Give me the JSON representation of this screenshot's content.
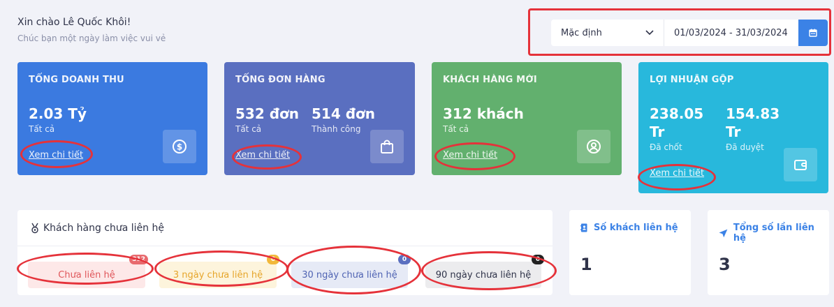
{
  "greeting": {
    "title": "Xin chào Lê Quốc Khôi!",
    "subtitle": "Chúc bạn một ngày làm việc vui vẻ"
  },
  "filter": {
    "preset": "Mặc định",
    "date_range": "01/03/2024 - 31/03/2024"
  },
  "cards": {
    "revenue": {
      "title": "TỔNG DOANH THU",
      "value": "2.03 Tỷ",
      "label": "Tất cả",
      "link": "Xem chi tiết",
      "color": "#3b7ae0",
      "icon": "dollar-coin-icon"
    },
    "orders": {
      "title": "TỔNG ĐƠN HÀNG",
      "value1": "532 đơn",
      "label1": "Tất cả",
      "value2": "514 đơn",
      "label2": "Thành công",
      "link": "Xem chi tiết",
      "color": "#5a6fc0",
      "icon": "shopping-bag-icon"
    },
    "customers": {
      "title": "KHÁCH HÀNG MỚI",
      "value": "312 khách",
      "label": "Tất cả",
      "link": "Xem chi tiết",
      "color": "#62b06e",
      "icon": "user-circle-icon"
    },
    "profit": {
      "title": "LỢI NHUẬN GỘP",
      "value1": "238.05 Tr",
      "label1": "Đã chốt",
      "value2": "154.83 Tr",
      "label2": "Đã duyệt",
      "link": "Xem chi tiết",
      "color": "#28b8dc",
      "icon": "wallet-icon"
    }
  },
  "uncontacted": {
    "title": "Khách hàng chưa liên hệ",
    "pills": [
      {
        "label": "Chưa liên hệ",
        "count": "312",
        "bg": "#fde8e8",
        "fg": "#e0575b",
        "badge": "#e86a6e"
      },
      {
        "label": "3 ngày chưa liên hệ",
        "count": "0",
        "bg": "#fdf4dc",
        "fg": "#e6a52a",
        "badge": "#f2b83a"
      },
      {
        "label": "30 ngày chưa liên hệ",
        "count": "0",
        "bg": "#e6eaf6",
        "fg": "#4f63b3",
        "badge": "#5a6fc0"
      },
      {
        "label": "90 ngày chưa liên hệ",
        "count": "0",
        "bg": "#ececee",
        "fg": "#2f3349",
        "badge": "#222222"
      }
    ]
  },
  "stats": {
    "contacted_customers": {
      "title": "Số khách liên hệ",
      "value": "1",
      "icon": "contact-book-icon"
    },
    "total_contacts": {
      "title": "Tổng số lần liên hệ",
      "value": "3",
      "icon": "send-arrow-icon"
    }
  }
}
